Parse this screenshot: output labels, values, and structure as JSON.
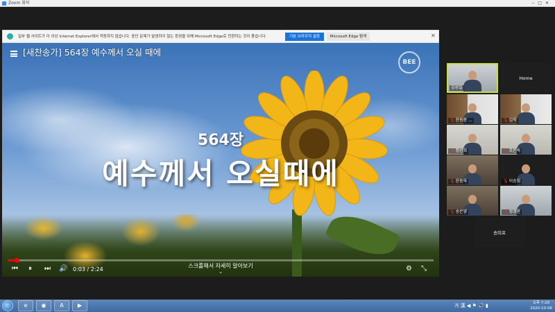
{
  "window": {
    "title": "Zoom 회의"
  },
  "ie_banner": {
    "message": "일부 웹 사이트가 더 이상 Internet Explorer에서 작동하지 않습니다. 중단 문제가 발생하지 않는 환경을 위해 Microsoft Edge로 전환하는 것이 좋습니다.",
    "default_button": "기본 브라우저 설정",
    "edge_button": "Microsoft Edge 탐색"
  },
  "video": {
    "title": "[새찬송가] 564장 예수께서 오실 때에",
    "channel_logo": "BEE",
    "overlay_number": "564장",
    "overlay_title": "예수께서 오실때에",
    "time_current": "0:03",
    "time_total": "2:24",
    "progress_fraction": 0.021,
    "scroll_hint": "스크롤해서 자세히 알아보기"
  },
  "participants": [
    {
      "name": "김성일",
      "muted": false,
      "video": true,
      "active": true,
      "bg": "bg-office"
    },
    {
      "name": "Home",
      "muted": false,
      "video": false,
      "active": false,
      "bg": "bg-dark"
    },
    {
      "name": "윤동환 ...",
      "muted": true,
      "video": true,
      "active": false,
      "bg": "bg-books"
    },
    {
      "name": "김학",
      "muted": true,
      "video": true,
      "active": false,
      "bg": "bg-books"
    },
    {
      "name": "정선희",
      "muted": true,
      "video": true,
      "active": false,
      "bg": "bg-light"
    },
    {
      "name": "조은숙",
      "muted": true,
      "video": true,
      "active": false,
      "bg": "bg-light"
    },
    {
      "name": "윤동욱",
      "muted": true,
      "video": true,
      "active": false,
      "bg": "bg-room"
    },
    {
      "name": "이승희",
      "muted": true,
      "video": true,
      "active": false,
      "bg": "bg-dark"
    },
    {
      "name": "송은영",
      "muted": true,
      "video": true,
      "active": false,
      "bg": "bg-room"
    },
    {
      "name": "정경환",
      "muted": true,
      "video": true,
      "active": false,
      "bg": "bg-office"
    },
    {
      "name": "송미프",
      "muted": false,
      "video": false,
      "active": false,
      "bg": "bg-dark"
    }
  ],
  "taskbar": {
    "tray_text": "가 漢",
    "time": "오후 7:20",
    "date": "2020-10-06"
  },
  "colors": {
    "progress": "#ff0000",
    "active_speaker": "#c4e23a",
    "ie_primary": "#1a73d9"
  }
}
